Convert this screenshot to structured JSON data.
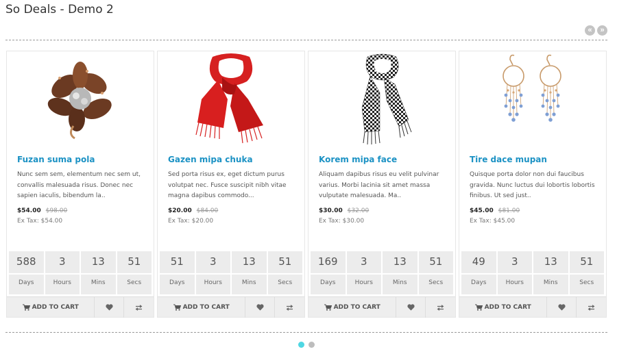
{
  "header": {
    "title": "So Deals - Demo 2",
    "prev_label": "«",
    "next_label": "»"
  },
  "labels": {
    "days": "Days",
    "hours": "Hours",
    "mins": "Mins",
    "secs": "Secs",
    "add_to_cart": "ADD TO CART"
  },
  "products": [
    {
      "name": "Fuzan suma pola",
      "description": "Nunc sem sem, elementum nec sem ut, convallis malesuada risus. Donec nec sapien iaculis, bibendum la..",
      "price": "$54.00",
      "old_price": "$98.00",
      "ex_tax": "Ex Tax: $54.00",
      "countdown": {
        "days": "588",
        "hours": "3",
        "mins": "13",
        "secs": "51"
      },
      "image": "brooch-image"
    },
    {
      "name": "Gazen mipa chuka",
      "description": "Sed porta risus ex, eget dictum purus volutpat nec. Fusce suscipit nibh vitae magna dapibus commodo...",
      "price": "$20.00",
      "old_price": "$84.00",
      "ex_tax": "Ex Tax: $20.00",
      "countdown": {
        "days": "51",
        "hours": "3",
        "mins": "13",
        "secs": "51"
      },
      "image": "red-scarf-image"
    },
    {
      "name": "Korem mipa face",
      "description": "Aliquam dapibus risus eu velit pulvinar varius. Morbi lacinia sit amet massa vulputate malesuada. Ma..",
      "price": "$30.00",
      "old_price": "$32.00",
      "ex_tax": "Ex Tax: $30.00",
      "countdown": {
        "days": "169",
        "hours": "3",
        "mins": "13",
        "secs": "51"
      },
      "image": "houndstooth-scarf-image"
    },
    {
      "name": "Tire dace mupan",
      "description": "Quisque porta dolor non dui faucibus gravida. Nunc luctus dui lobortis lobortis finibus. Ut sed just..",
      "price": "$45.00",
      "old_price": "$81.00",
      "ex_tax": "Ex Tax: $45.00",
      "countdown": {
        "days": "49",
        "hours": "3",
        "mins": "13",
        "secs": "51"
      },
      "image": "earrings-image"
    }
  ],
  "pager": {
    "pages": 2,
    "active": 1
  },
  "colors": {
    "accent": "#1c92c4",
    "pager_active": "#4fd7e3",
    "pager_inactive": "#bdbdbd"
  }
}
